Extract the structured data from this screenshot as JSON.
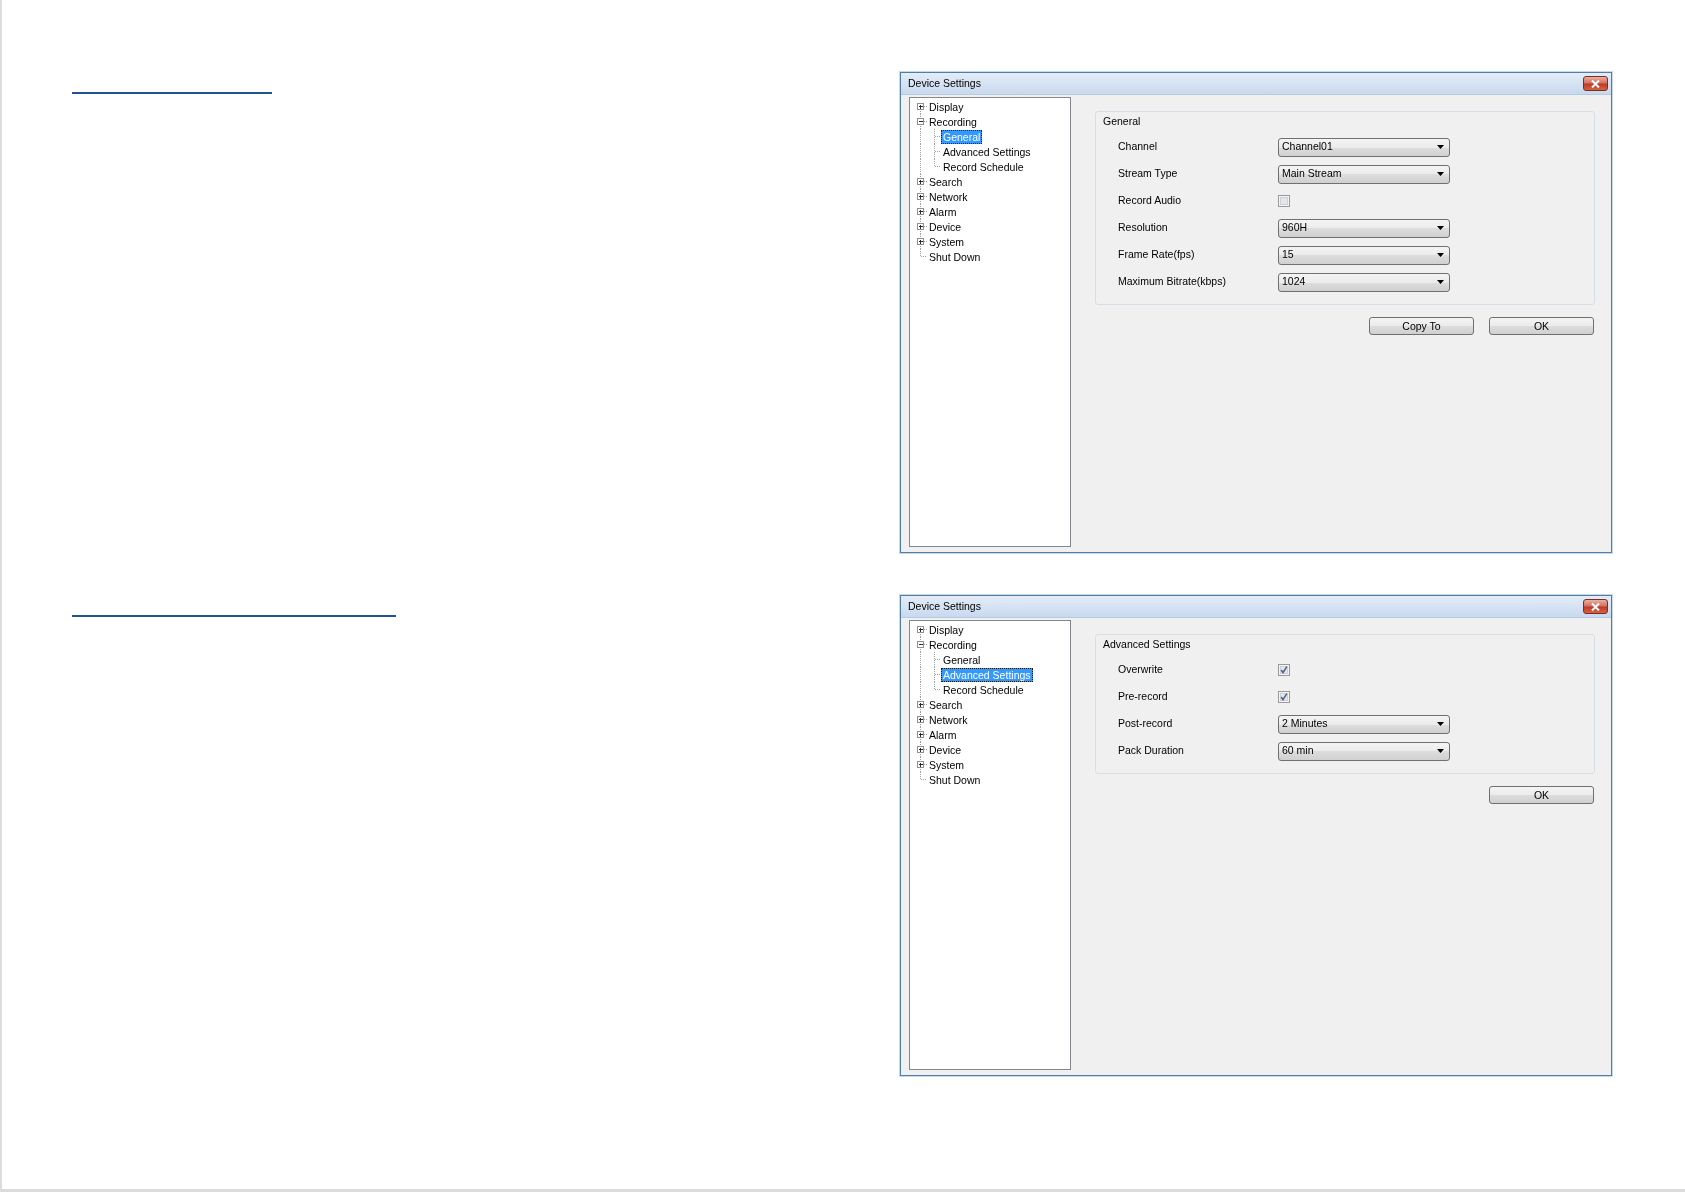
{
  "dialogs": [
    {
      "title": "Device Settings",
      "tree": [
        {
          "label": "Display",
          "kind": "folder",
          "expanded": false,
          "selected": false
        },
        {
          "label": "Recording",
          "kind": "folder",
          "expanded": true,
          "selected": false,
          "children": [
            {
              "label": "General",
              "kind": "leaf",
              "selected": true
            },
            {
              "label": "Advanced Settings",
              "kind": "leaf",
              "selected": false
            },
            {
              "label": "Record Schedule",
              "kind": "leaf",
              "selected": false
            }
          ]
        },
        {
          "label": "Search",
          "kind": "folder",
          "expanded": false,
          "selected": false
        },
        {
          "label": "Network",
          "kind": "folder",
          "expanded": false,
          "selected": false
        },
        {
          "label": "Alarm",
          "kind": "folder",
          "expanded": false,
          "selected": false
        },
        {
          "label": "Device",
          "kind": "folder",
          "expanded": false,
          "selected": false
        },
        {
          "label": "System",
          "kind": "folder",
          "expanded": false,
          "selected": false
        },
        {
          "label": "Shut Down",
          "kind": "leaf",
          "selected": false
        }
      ],
      "panel": {
        "title": "General",
        "fields": [
          {
            "kind": "dropdown",
            "label": "Channel",
            "value": "Channel01"
          },
          {
            "kind": "dropdown",
            "label": "Stream Type",
            "value": "Main Stream"
          },
          {
            "kind": "checkbox",
            "label": "Record Audio",
            "checked": false
          },
          {
            "kind": "dropdown",
            "label": "Resolution",
            "value": "960H"
          },
          {
            "kind": "dropdown",
            "label": "Frame Rate(fps)",
            "value": "15"
          },
          {
            "kind": "dropdown",
            "label": "Maximum Bitrate(kbps)",
            "value": "1024"
          }
        ]
      },
      "buttons": [
        "Copy To",
        "OK"
      ]
    },
    {
      "title": "Device Settings",
      "tree": [
        {
          "label": "Display",
          "kind": "folder",
          "expanded": false,
          "selected": false
        },
        {
          "label": "Recording",
          "kind": "folder",
          "expanded": true,
          "selected": false,
          "children": [
            {
              "label": "General",
              "kind": "leaf",
              "selected": false
            },
            {
              "label": "Advanced Settings",
              "kind": "leaf",
              "selected": true
            },
            {
              "label": "Record Schedule",
              "kind": "leaf",
              "selected": false
            }
          ]
        },
        {
          "label": "Search",
          "kind": "folder",
          "expanded": false,
          "selected": false
        },
        {
          "label": "Network",
          "kind": "folder",
          "expanded": false,
          "selected": false
        },
        {
          "label": "Alarm",
          "kind": "folder",
          "expanded": false,
          "selected": false
        },
        {
          "label": "Device",
          "kind": "folder",
          "expanded": false,
          "selected": false
        },
        {
          "label": "System",
          "kind": "folder",
          "expanded": false,
          "selected": false
        },
        {
          "label": "Shut Down",
          "kind": "leaf",
          "selected": false
        }
      ],
      "panel": {
        "title": "Advanced Settings",
        "fields": [
          {
            "kind": "checkbox",
            "label": "Overwrite",
            "checked": true
          },
          {
            "kind": "checkbox",
            "label": "Pre-record",
            "checked": true
          },
          {
            "kind": "dropdown",
            "label": "Post-record",
            "value": "2 Minutes"
          },
          {
            "kind": "dropdown",
            "label": "Pack Duration",
            "value": "60 min"
          }
        ]
      },
      "buttons": [
        "OK"
      ]
    }
  ]
}
